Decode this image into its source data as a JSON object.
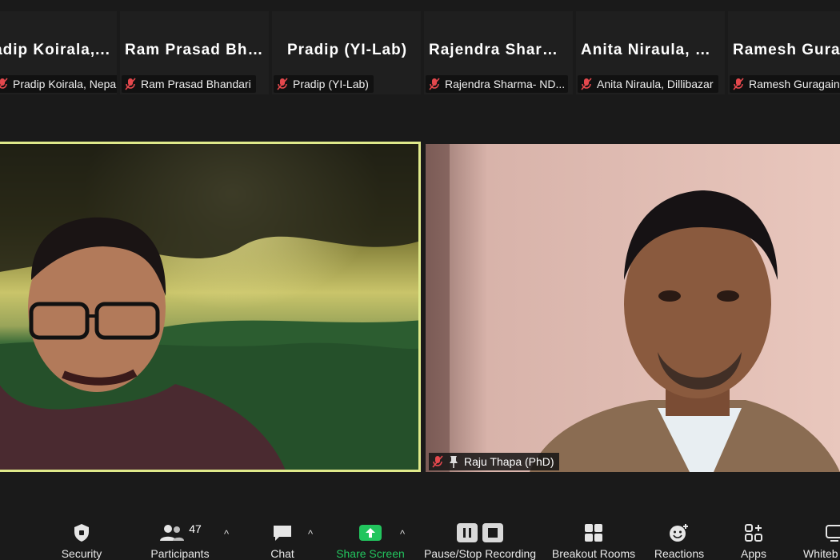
{
  "participants_strip": [
    {
      "display": "Pradip Koirala,...",
      "caption": "Pradip Koirala, Nepal"
    },
    {
      "display": "Ram Prasad Bha...",
      "caption": "Ram Prasad Bhandari"
    },
    {
      "display": "Pradip (YI-Lab)",
      "caption": "Pradip (YI-Lab)"
    },
    {
      "display": "Rajendra Sharm...",
      "caption": "Rajendra Sharma- ND..."
    },
    {
      "display": "Anita Niraula, D...",
      "caption": "Anita Niraula, Dillibazar"
    },
    {
      "display": "Ramesh Gurag...",
      "caption": "Ramesh Guragain"
    }
  ],
  "main_videos": {
    "right_name": "Raju Thapa (PhD)"
  },
  "toolbar": {
    "security": "Security",
    "participants": "Participants",
    "participants_count": "47",
    "chat": "Chat",
    "share_screen": "Share Screen",
    "recording": "Pause/Stop Recording",
    "breakout": "Breakout Rooms",
    "reactions": "Reactions",
    "apps": "Apps",
    "whiteboard": "Whiteb"
  },
  "colors": {
    "active_speaker_border": "#dfe98a",
    "share_green": "#22c55e",
    "muted_red": "#e5484d"
  }
}
